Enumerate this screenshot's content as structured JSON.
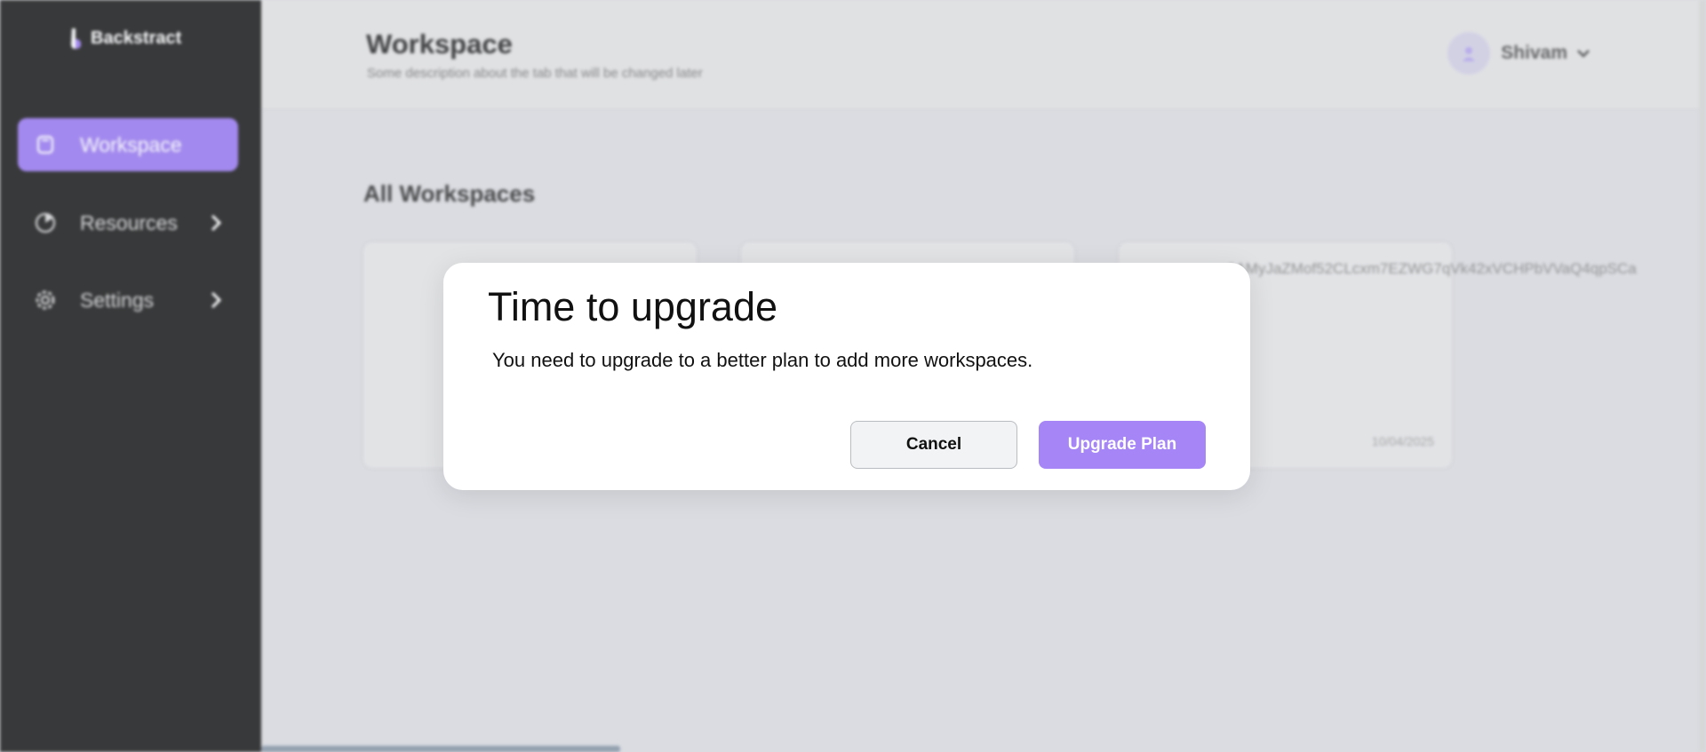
{
  "sidebar": {
    "brand": "Backstract",
    "items": [
      {
        "label": "Workspace",
        "icon": "workspace-icon",
        "active": true
      },
      {
        "label": "Resources",
        "icon": "resources-icon",
        "active": false
      },
      {
        "label": "Settings",
        "icon": "gear-icon",
        "active": false
      }
    ]
  },
  "header": {
    "title": "Workspace",
    "subtitle": "Some description about the tab that will be changed later",
    "user_name": "Shivam"
  },
  "main": {
    "section_title": "All Workspaces",
    "cards": [
      {
        "id_text": "",
        "date": ""
      },
      {
        "id_text": "",
        "date": ""
      },
      {
        "id_text": "0AMyJaZMof52CLcxm7EZWG7qVk42xVCHPbVVaQ4qpSCa",
        "date": "10/04/2025"
      }
    ]
  },
  "modal": {
    "title": "Time to upgrade",
    "message": "You need to upgrade to a better plan to add more workspaces.",
    "cancel_label": "Cancel",
    "upgrade_label": "Upgrade Plan"
  },
  "colors": {
    "accent": "#a685f6",
    "sidebar_bg": "#1e1e1e",
    "active_nav": "#9b7cf2"
  }
}
